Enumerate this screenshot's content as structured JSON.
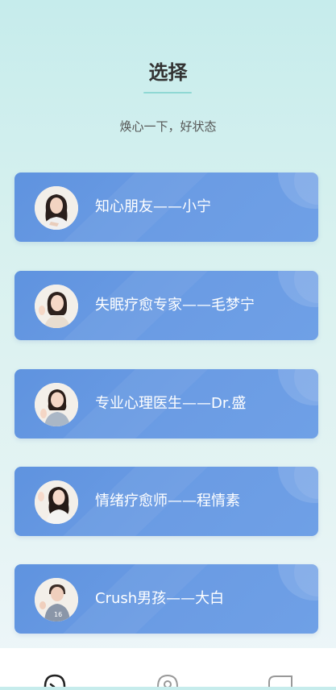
{
  "header": {
    "title": "选择",
    "subtitle": "焕心一下，好状态"
  },
  "cards": [
    {
      "label": "知心朋友——小宁",
      "avatar": "avatar-woman-long-hair"
    },
    {
      "label": "失眠疗愈专家——毛梦宁",
      "avatar": "avatar-woman-waving"
    },
    {
      "label": "专业心理医生——Dr.盛",
      "avatar": "avatar-woman-hand-raised"
    },
    {
      "label": "情绪疗愈师——程情素",
      "avatar": "avatar-woman-waving-2"
    },
    {
      "label": "Crush男孩——大白",
      "avatar": "avatar-boy-jersey"
    }
  ],
  "tabbar": {
    "tabs": [
      {
        "icon": "chat-icon"
      },
      {
        "icon": "discover-icon"
      },
      {
        "icon": "profile-icon"
      }
    ]
  },
  "colors": {
    "card": "#6597e1",
    "title": "#333333",
    "accent": "#8fd8d4"
  }
}
